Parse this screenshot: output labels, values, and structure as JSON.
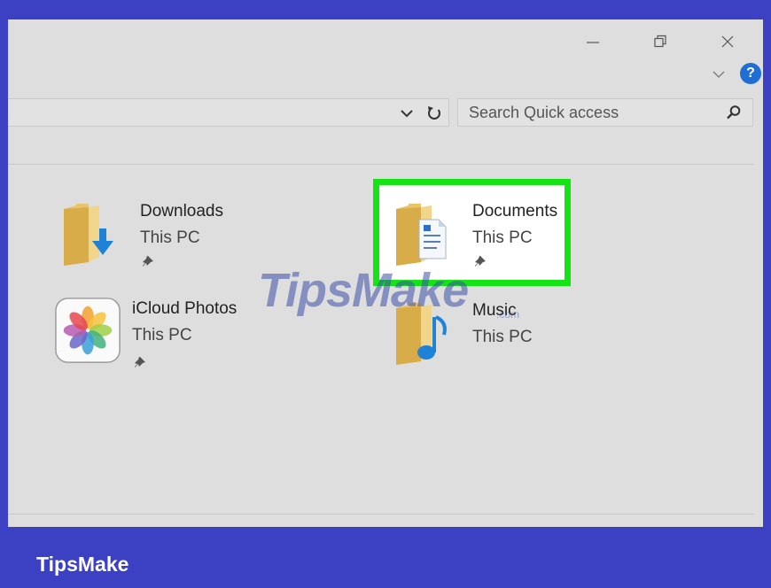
{
  "window": {
    "controls": {
      "minimize": "minimize",
      "restore": "restore",
      "close": "close"
    },
    "help_label": "?"
  },
  "toolbar": {
    "search": {
      "placeholder": "Search Quick access"
    }
  },
  "quick_access": {
    "items": [
      {
        "name": "Downloads",
        "location": "This PC",
        "icon": "downloads-folder-icon",
        "pinned": true,
        "highlighted": false
      },
      {
        "name": "Documents",
        "location": "This PC",
        "icon": "documents-folder-icon",
        "pinned": true,
        "highlighted": true
      },
      {
        "name": "iCloud Photos",
        "location": "This PC",
        "icon": "icloud-photos-icon",
        "pinned": true,
        "highlighted": false
      },
      {
        "name": "Music",
        "location": "This PC",
        "icon": "music-folder-icon",
        "pinned": false,
        "highlighted": false
      }
    ]
  },
  "watermark": {
    "text": "TipsMake",
    "sub": ".com"
  },
  "brand": {
    "text": "TipsMake"
  },
  "colors": {
    "frame": "#3c40c2",
    "highlight": "#14e414",
    "help": "#1f6ed4",
    "folder": "#e8c46a"
  }
}
